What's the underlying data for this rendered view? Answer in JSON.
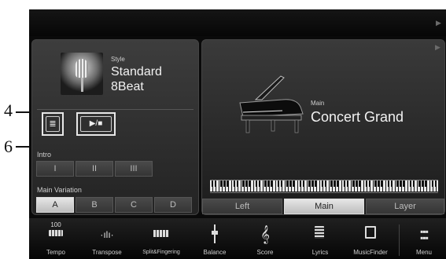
{
  "callouts": {
    "c4": "4",
    "c6": "6"
  },
  "style_panel": {
    "category_label": "Style",
    "name_line1": "Standard",
    "name_line2": "8Beat",
    "intro_label": "Intro",
    "intro_buttons": [
      "I",
      "II",
      "III"
    ],
    "main_variation_label": "Main Variation",
    "variation_buttons": [
      "A",
      "B",
      "C",
      "D"
    ],
    "selected_variation": "A",
    "start_stop_glyph": "▶/■"
  },
  "voice_panel": {
    "part_label": "Main",
    "voice_name": "Concert Grand",
    "part_tabs": [
      "Left",
      "Main",
      "Layer"
    ],
    "selected_part": "Main"
  },
  "footer": {
    "items": [
      {
        "label": "Tempo",
        "value": "100",
        "icon": "tempo-icon"
      },
      {
        "label": "Transpose",
        "icon": "transpose-icon"
      },
      {
        "label": "Split&Fingering",
        "icon": "keyboard-split-icon"
      },
      {
        "label": "Balance",
        "icon": "balance-icon"
      },
      {
        "label": "Score",
        "icon": "treble-clef-icon"
      },
      {
        "label": "Lyrics",
        "icon": "lyrics-icon"
      },
      {
        "label": "MusicFinder",
        "icon": "music-finder-icon"
      },
      {
        "label": "Menu",
        "icon": "menu-grid-icon"
      }
    ]
  }
}
